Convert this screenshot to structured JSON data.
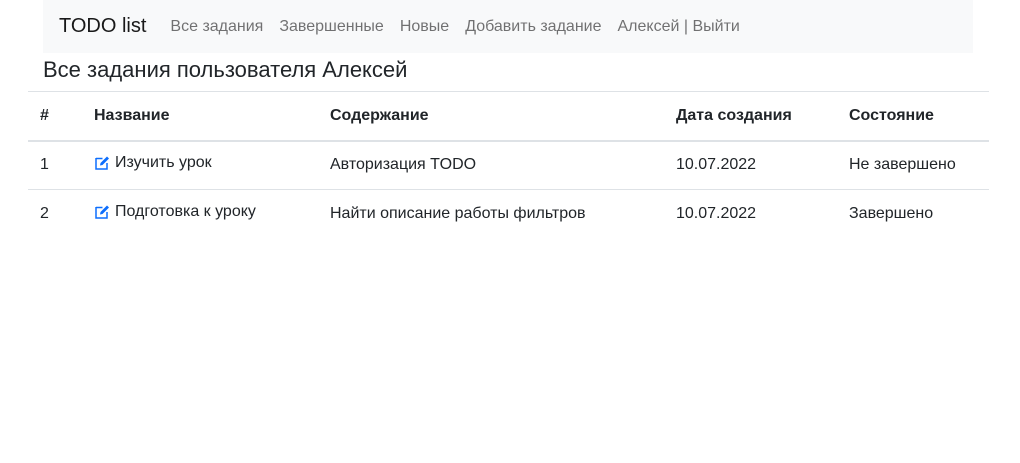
{
  "navbar": {
    "brand": "TODO list",
    "links": [
      "Все задания",
      "Завершенные",
      "Новые",
      "Добавить задание"
    ],
    "user_link": "Алексей | Выйти"
  },
  "page": {
    "title": "Все задания пользователя Алексей"
  },
  "table": {
    "headers": [
      "#",
      "Название",
      "Содержание",
      "Дата создания",
      "Состояние"
    ],
    "rows": [
      {
        "num": "1",
        "name": "Изучить урок",
        "content": "Авторизация TODO",
        "date": "10.07.2022",
        "status": "Не завершено",
        "icon": "edit-icon"
      },
      {
        "num": "2",
        "name": "Подготовка к уроку",
        "content": "Найти описание работы фильтров",
        "date": "10.07.2022",
        "status": "Завершено",
        "icon": "edit-icon"
      }
    ]
  },
  "colors": {
    "navbar_bg": "#f8f9fa",
    "icon": "#0d6efd",
    "border": "#dee2e6"
  }
}
